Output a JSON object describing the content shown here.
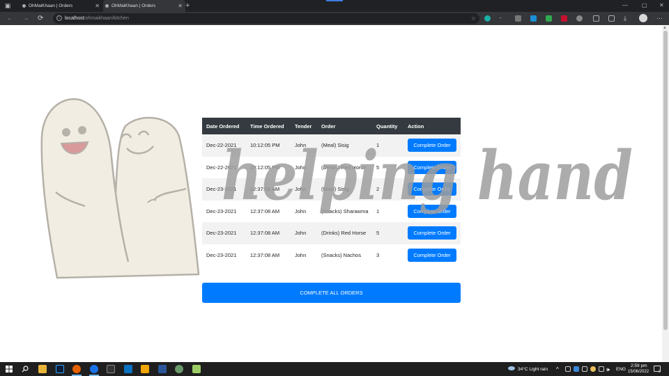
{
  "browser": {
    "tabs": [
      {
        "title": "OhMaiKhaan | Orders",
        "active": false
      },
      {
        "title": "OhMaiKhaan | Orders",
        "active": true
      }
    ],
    "new_tab_symbol": "+",
    "close_symbol": "✕",
    "url_host": "localhost",
    "url_path": "/ohmaikhaan/kitchen",
    "window_controls": {
      "minimize": "—",
      "maximize": "▢",
      "close": "✕"
    },
    "nav": {
      "back": "←",
      "forward": "→",
      "reload": "⟳"
    }
  },
  "kitchen": {
    "columns": [
      "Date Ordered",
      "Time Ordered",
      "Tender",
      "Order",
      "Quantity",
      "Action"
    ],
    "orders": [
      {
        "date": "Dec-22-2021",
        "time": "10:12:05 PM",
        "tender": "John",
        "order": "(Meal) Sisig",
        "quantity": "1",
        "action": "Complete Order"
      },
      {
        "date": "Dec-22-2021",
        "time": "10:12:05 PM",
        "tender": "John",
        "order": "(Drinks) Red Horse",
        "quantity": "5",
        "action": "Complete Order"
      },
      {
        "date": "Dec-23-2021",
        "time": "12:37:08 AM",
        "tender": "John",
        "order": "(Meal) Sisig",
        "quantity": "2",
        "action": "Complete Order"
      },
      {
        "date": "Dec-23-2021",
        "time": "12:37:08 AM",
        "tender": "John",
        "order": "(Snacks) Sharawma",
        "quantity": "1",
        "action": "Complete Order"
      },
      {
        "date": "Dec-23-2021",
        "time": "12:37:08 AM",
        "tender": "John",
        "order": "(Drinks) Red Horse",
        "quantity": "5",
        "action": "Complete Order"
      },
      {
        "date": "Dec-23-2021",
        "time": "12:37:08 AM",
        "tender": "John",
        "order": "(Snacks) Nachos",
        "quantity": "3",
        "action": "Complete Order"
      }
    ],
    "complete_all_label": "Complete All Orders",
    "watermark_text": "helping hand"
  },
  "colors": {
    "primary": "#007bff",
    "table_header": "#343a40",
    "stripe": "#f2f2f2",
    "watermark": "#9e9e9e"
  },
  "taskbar": {
    "weather": "34°C  Light rain",
    "language": "ENG",
    "time": "2:59 pm",
    "date": "15/06/2022",
    "notification_count": "2"
  }
}
